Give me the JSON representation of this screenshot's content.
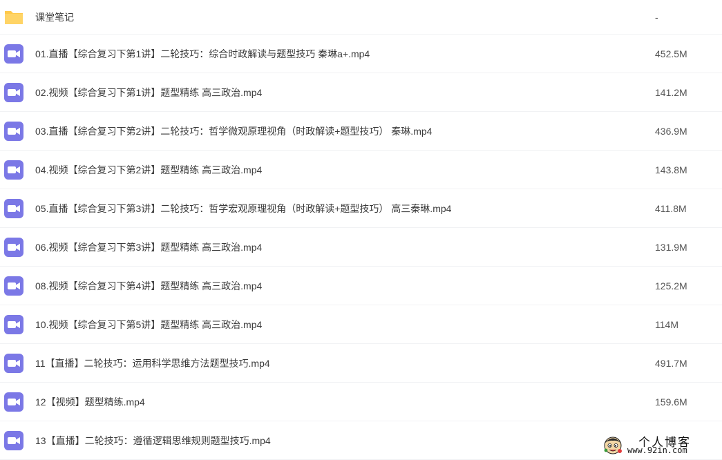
{
  "colors": {
    "folder_icon": "#ffc94b",
    "video_icon": "#7b78e6",
    "divider": "#f1f2f4",
    "text": "#3b3b3b"
  },
  "files": [
    {
      "icon": "folder-icon",
      "name": "课堂笔记",
      "size": "-"
    },
    {
      "icon": "video-icon",
      "name": "01.直播【综合复习下第1讲】二轮技巧：综合时政解读与题型技巧 秦琳a+.mp4",
      "size": "452.5M"
    },
    {
      "icon": "video-icon",
      "name": "02.视频【综合复习下第1讲】题型精练 高三政治.mp4",
      "size": "141.2M"
    },
    {
      "icon": "video-icon",
      "name": "03.直播【综合复习下第2讲】二轮技巧：哲学微观原理视角（时政解读+题型技巧） 秦琳.mp4",
      "size": "436.9M"
    },
    {
      "icon": "video-icon",
      "name": "04.视频【综合复习下第2讲】题型精练 高三政治.mp4",
      "size": "143.8M"
    },
    {
      "icon": "video-icon",
      "name": "05.直播【综合复习下第3讲】二轮技巧：哲学宏观原理视角（时政解读+题型技巧） 高三秦琳.mp4",
      "size": "411.8M"
    },
    {
      "icon": "video-icon",
      "name": "06.视频【综合复习下第3讲】题型精练 高三政治.mp4",
      "size": "131.9M"
    },
    {
      "icon": "video-icon",
      "name": "08.视频【综合复习下第4讲】题型精练 高三政治.mp4",
      "size": "125.2M"
    },
    {
      "icon": "video-icon",
      "name": "10.视频【综合复习下第5讲】题型精练 高三政治.mp4",
      "size": "114M"
    },
    {
      "icon": "video-icon",
      "name": "11【直播】二轮技巧：运用科学思维方法题型技巧.mp4",
      "size": "491.7M"
    },
    {
      "icon": "video-icon",
      "name": "12【视频】题型精练.mp4",
      "size": "159.6M"
    },
    {
      "icon": "video-icon",
      "name": "13【直播】二轮技巧：遵循逻辑思维规则题型技巧.mp4",
      "size": ""
    }
  ],
  "watermark": {
    "title": "个人博客",
    "url": "www.92in.com",
    "logo_icon": "cartoon-face-logo"
  }
}
